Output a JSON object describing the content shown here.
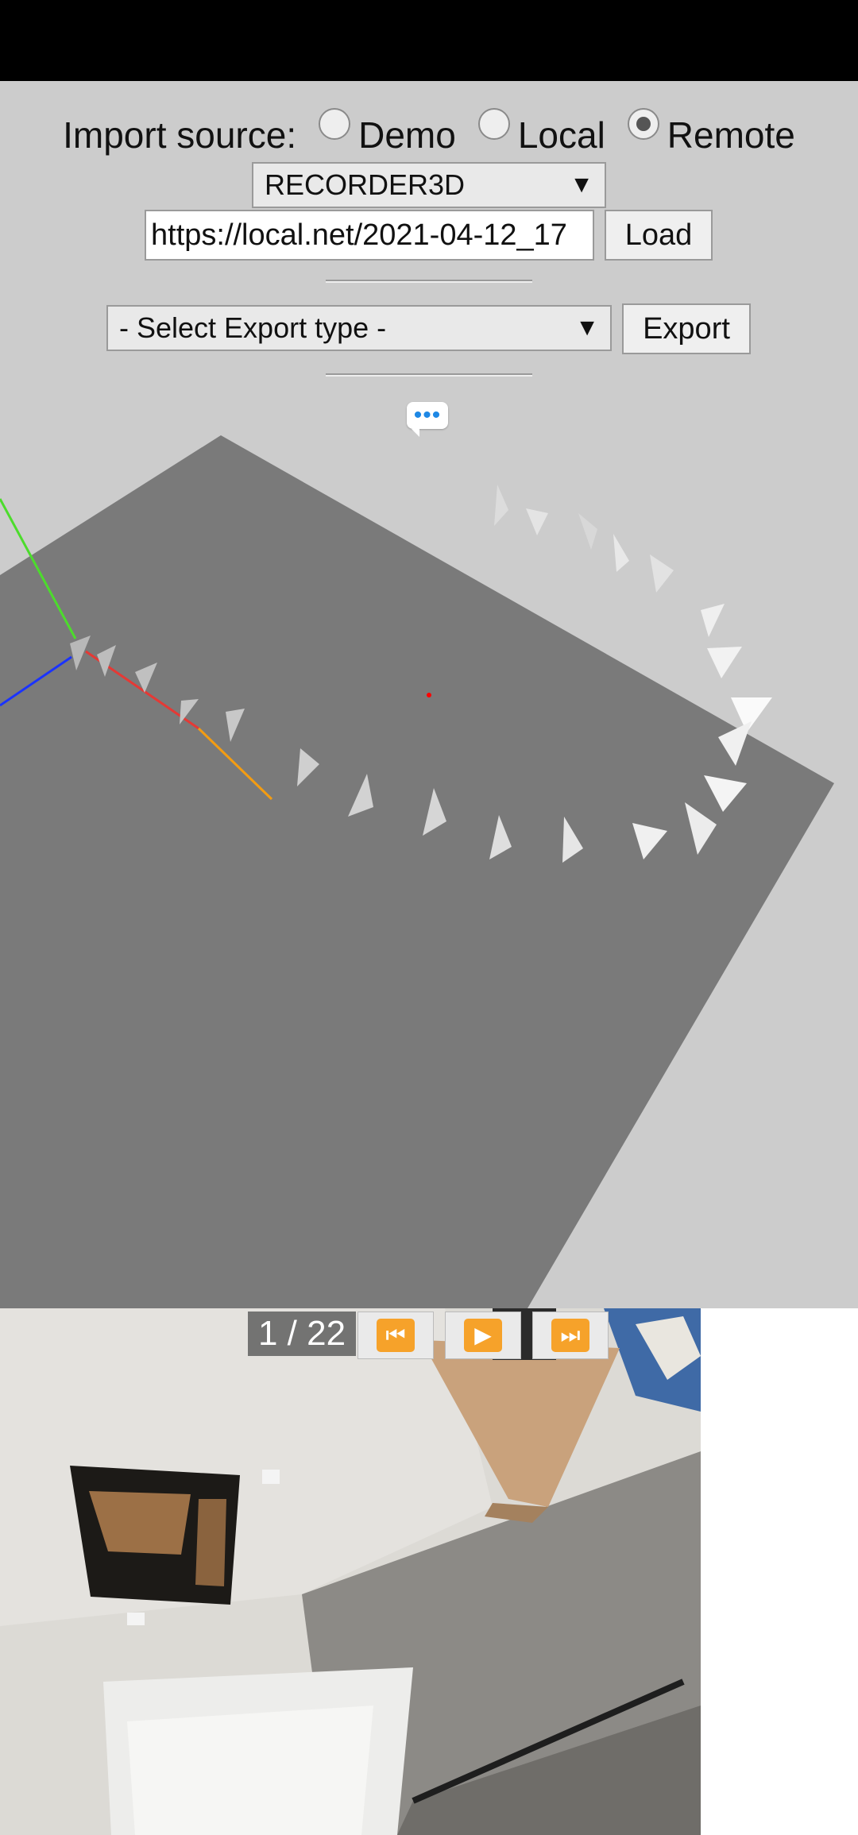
{
  "import": {
    "label": "Import source:",
    "options": [
      {
        "label": "Demo",
        "checked": false
      },
      {
        "label": "Local",
        "checked": false
      },
      {
        "label": "Remote",
        "checked": true
      }
    ],
    "format_selected": "RECORDER3D",
    "url_value": "https://local.net/2021-04-12_17",
    "load_label": "Load"
  },
  "export": {
    "type_selected": "- Select Export type -",
    "export_label": "Export"
  },
  "overflow": {
    "dots": "•••"
  },
  "player": {
    "counter": "1 / 22",
    "first_icon": "⏮",
    "play_icon": "▶",
    "last_icon": "⏭"
  },
  "icons": {
    "first": "skip-to-start-icon",
    "play": "play-icon",
    "last": "skip-to-end-icon"
  },
  "colors": {
    "accent_orange": "#f6a22a",
    "ground_plane": "#7a7a7a",
    "axis_x": "#e53935",
    "axis_y": "#4cdc2c",
    "axis_z": "#1a33ff"
  }
}
